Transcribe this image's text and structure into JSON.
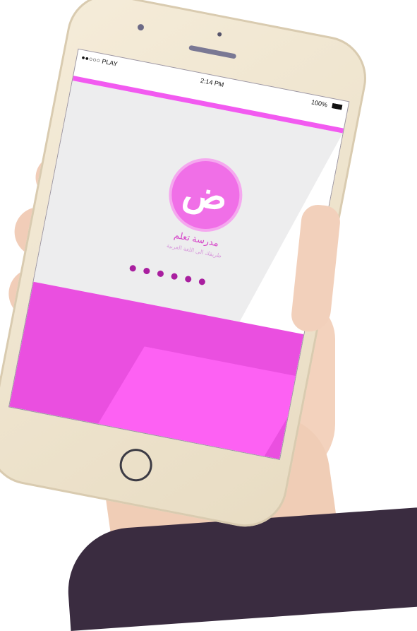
{
  "status_bar": {
    "carrier": "●●○○○ PLAY",
    "time": "2:14 PM",
    "battery": "100%"
  },
  "app": {
    "logo_glyph": "ض",
    "brand_name": "مدرسة تعلم",
    "tagline": "طريقك الى اللغة العربية"
  },
  "loader": {
    "dot_count": 6
  },
  "colors": {
    "accent": "#f25af0",
    "pink": "#ea4fe0",
    "dots": "#a91f9f",
    "gray": "#ededee"
  }
}
